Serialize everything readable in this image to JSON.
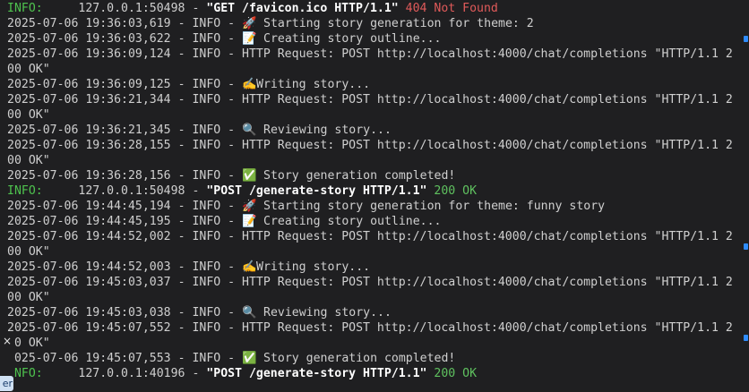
{
  "log_lines": [
    {
      "type": "access",
      "level": "INFO:",
      "client": "127.0.0.1:50498",
      "request": "\"GET /favicon.ico HTTP/1.1\"",
      "status": "404 Not Found",
      "status_kind": "err"
    },
    {
      "type": "app",
      "ts": "2025-07-06 19:36:03,619",
      "level": "INFO",
      "emoji": "🚀",
      "msg": "Starting story generation for theme: 2"
    },
    {
      "type": "app",
      "ts": "2025-07-06 19:36:03,622",
      "level": "INFO",
      "emoji": "📝",
      "msg": "Creating story outline..."
    },
    {
      "type": "app",
      "ts": "2025-07-06 19:36:09,124",
      "level": "INFO",
      "emoji": "",
      "msg": "HTTP Request: POST http://localhost:4000/chat/completions \"HTTP/1.1 2"
    },
    {
      "type": "cont",
      "msg": "00 OK\""
    },
    {
      "type": "app",
      "ts": "2025-07-06 19:36:09,125",
      "level": "INFO",
      "emoji": "✍️",
      "msg": "Writing story..."
    },
    {
      "type": "app",
      "ts": "2025-07-06 19:36:21,344",
      "level": "INFO",
      "emoji": "",
      "msg": "HTTP Request: POST http://localhost:4000/chat/completions \"HTTP/1.1 2"
    },
    {
      "type": "cont",
      "msg": "00 OK\""
    },
    {
      "type": "app",
      "ts": "2025-07-06 19:36:21,345",
      "level": "INFO",
      "emoji": "🔍",
      "msg": "Reviewing story..."
    },
    {
      "type": "app",
      "ts": "2025-07-06 19:36:28,155",
      "level": "INFO",
      "emoji": "",
      "msg": "HTTP Request: POST http://localhost:4000/chat/completions \"HTTP/1.1 2"
    },
    {
      "type": "cont",
      "msg": "00 OK\""
    },
    {
      "type": "app",
      "ts": "2025-07-06 19:36:28,156",
      "level": "INFO",
      "emoji": "✅",
      "msg": "Story generation completed!"
    },
    {
      "type": "access",
      "level": "INFO:",
      "client": "127.0.0.1:50498",
      "request": "\"POST /generate-story HTTP/1.1\"",
      "status": "200 OK",
      "status_kind": "ok"
    },
    {
      "type": "app",
      "ts": "2025-07-06 19:44:45,194",
      "level": "INFO",
      "emoji": "🚀",
      "msg": "Starting story generation for theme: funny story"
    },
    {
      "type": "app",
      "ts": "2025-07-06 19:44:45,195",
      "level": "INFO",
      "emoji": "📝",
      "msg": "Creating story outline..."
    },
    {
      "type": "app",
      "ts": "2025-07-06 19:44:52,002",
      "level": "INFO",
      "emoji": "",
      "msg": "HTTP Request: POST http://localhost:4000/chat/completions \"HTTP/1.1 2"
    },
    {
      "type": "cont",
      "msg": "00 OK\""
    },
    {
      "type": "app",
      "ts": "2025-07-06 19:44:52,003",
      "level": "INFO",
      "emoji": "✍️",
      "msg": "Writing story..."
    },
    {
      "type": "app",
      "ts": "2025-07-06 19:45:03,037",
      "level": "INFO",
      "emoji": "",
      "msg": "HTTP Request: POST http://localhost:4000/chat/completions \"HTTP/1.1 2"
    },
    {
      "type": "cont",
      "msg": "00 OK\""
    },
    {
      "type": "app",
      "ts": "2025-07-06 19:45:03,038",
      "level": "INFO",
      "emoji": "🔍",
      "msg": "Reviewing story..."
    },
    {
      "type": "app",
      "ts": "2025-07-06 19:45:07,552",
      "level": "INFO",
      "emoji": "",
      "msg": "HTTP Request: POST http://localhost:4000/chat/completions \"HTTP/1.1 2"
    },
    {
      "type": "cont",
      "msg": "00 OK\""
    },
    {
      "type": "app",
      "ts": "2025-07-06 19:45:07,553",
      "level": "INFO",
      "emoji": "✅",
      "msg": "Story generation completed!"
    },
    {
      "type": "access",
      "level": "INFO:",
      "client": "127.0.0.1:40196",
      "request": "\"POST /generate-story HTTP/1.1\"",
      "status": "200 OK",
      "status_kind": "ok"
    }
  ],
  "overlay": {
    "close_glyph": "×",
    "side_tab_text": "er"
  },
  "colors": {
    "background": "#1f1f21",
    "text": "#cfcfcf",
    "info_green": "#4ec24e",
    "status_ok": "#5fc15f",
    "status_err": "#e05a5a",
    "scroll_marker": "#2f8cff"
  }
}
